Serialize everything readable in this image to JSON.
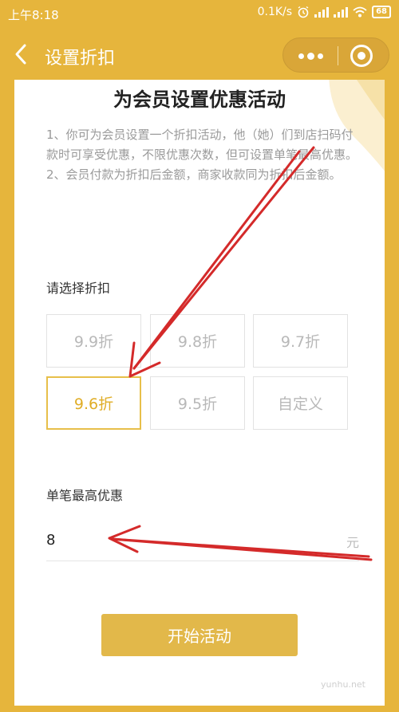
{
  "status_bar": {
    "time": "上午8:18",
    "network_speed": "0.1K/s",
    "battery": "68",
    "icons": [
      "alarm-icon",
      "signal-icon",
      "signal-icon",
      "wifi-icon",
      "battery-icon"
    ]
  },
  "nav": {
    "title": "设置折扣",
    "icons": [
      "back-arrow-icon",
      "more-dots-icon",
      "close-circle-icon"
    ]
  },
  "page": {
    "title": "为会员设置优惠活动",
    "desc_line1": "1、你可为会员设置一个折扣活动，他（她）们到店扫码付款时可享受优惠，不限优惠次数，但可设置单笔最高优惠。",
    "desc_line2": "2、会员付款为折扣后金额，商家收款同为折扣后金额。",
    "discount_label": "请选择折扣",
    "discount_options": [
      "9.9折",
      "9.8折",
      "9.7折",
      "9.6折",
      "9.5折",
      "自定义"
    ],
    "selected_discount": "9.6折",
    "max_label": "单笔最高优惠",
    "max_value": "8",
    "max_unit": "元",
    "start_button": "开始活动",
    "watermark": "yunhu.net"
  },
  "colors": {
    "background": "#e6b53c",
    "accent": "#e0ad26",
    "button": "#e2b84a",
    "annotation_arrow": "#d42a2a"
  }
}
